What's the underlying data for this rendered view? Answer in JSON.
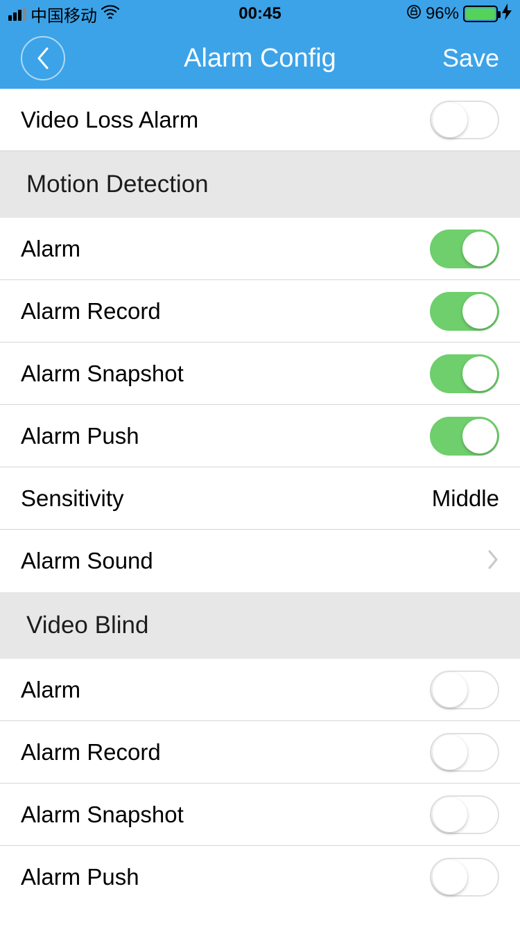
{
  "status_bar": {
    "carrier": "中国移动",
    "time": "00:45",
    "battery_pct": "96%"
  },
  "nav": {
    "title": "Alarm Config",
    "save": "Save"
  },
  "top_row": {
    "video_loss": "Video Loss Alarm"
  },
  "sections": {
    "motion": {
      "title": "Motion Detection",
      "alarm": "Alarm",
      "record": "Alarm Record",
      "snapshot": "Alarm Snapshot",
      "push": "Alarm Push",
      "sensitivity_label": "Sensitivity",
      "sensitivity_value": "Middle",
      "sound": "Alarm Sound"
    },
    "blind": {
      "title": "Video Blind",
      "alarm": "Alarm",
      "record": "Alarm Record",
      "snapshot": "Alarm Snapshot",
      "push": "Alarm Push"
    }
  }
}
